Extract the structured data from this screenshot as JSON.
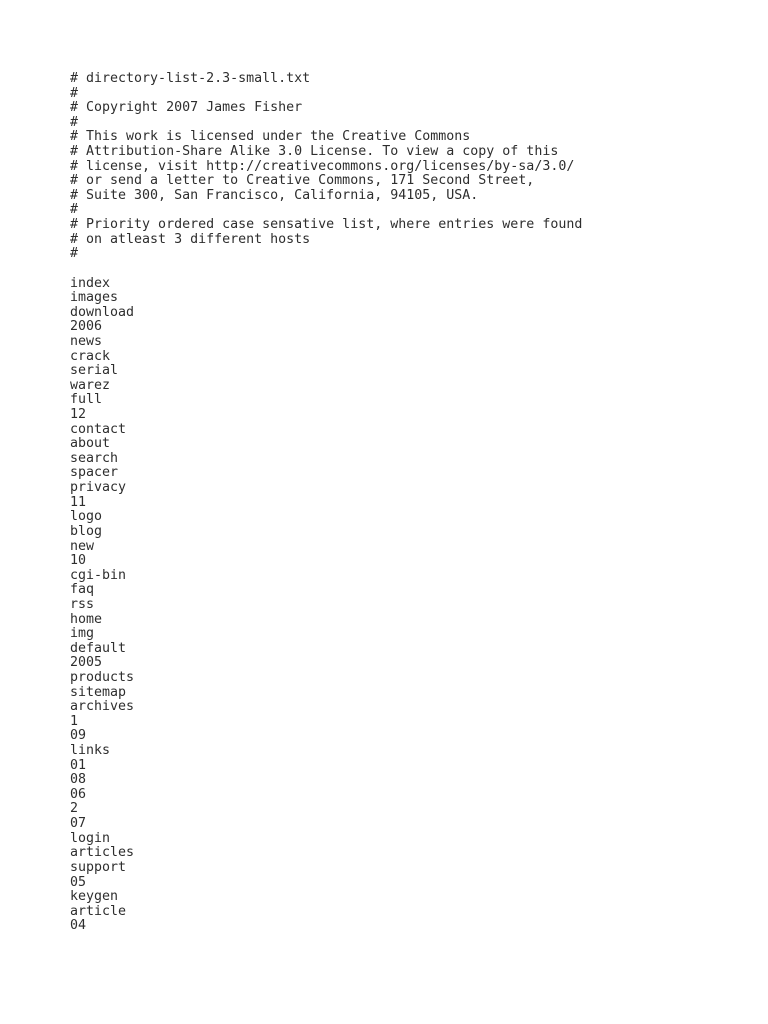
{
  "document": {
    "kind": "plain-text-file",
    "filename": "directory-list-2.3-small.txt",
    "background_color": "#ffffff",
    "text_color": "#2e2e2e"
  },
  "header_comments": [
    "# directory-list-2.3-small.txt",
    "#",
    "# Copyright 2007 James Fisher",
    "#",
    "# This work is licensed under the Creative Commons",
    "# Attribution-Share Alike 3.0 License. To view a copy of this",
    "# license, visit http://creativecommons.org/licenses/by-sa/3.0/",
    "# or send a letter to Creative Commons, 171 Second Street,",
    "# Suite 300, San Francisco, California, 94105, USA.",
    "#",
    "# Priority ordered case sensative list, where entries were found",
    "# on atleast 3 different hosts",
    "#"
  ],
  "separator_blank_line": "",
  "entries": [
    "index",
    "images",
    "download",
    "2006",
    "news",
    "crack",
    "serial",
    "warez",
    "full",
    "12",
    "contact",
    "about",
    "search",
    "spacer",
    "privacy",
    "11",
    "logo",
    "blog",
    "new",
    "10",
    "cgi-bin",
    "faq",
    "rss",
    "home",
    "img",
    "default",
    "2005",
    "products",
    "sitemap",
    "archives",
    "1",
    "09",
    "links",
    "01",
    "08",
    "06",
    "2",
    "07",
    "login",
    "articles",
    "support",
    "05",
    "keygen",
    "article",
    "04"
  ]
}
